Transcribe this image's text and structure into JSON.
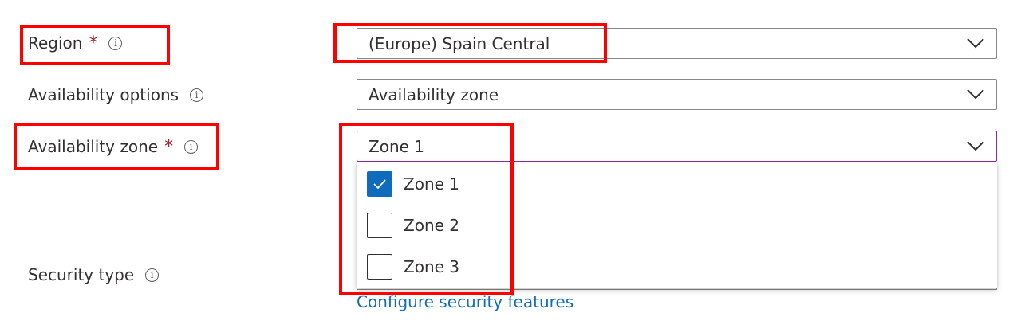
{
  "form": {
    "region": {
      "label": "Region",
      "required_mark": "*",
      "value": "(Europe) Spain Central"
    },
    "availability_options": {
      "label": "Availability options",
      "value": "Availability zone"
    },
    "availability_zone": {
      "label": "Availability zone",
      "required_mark": "*",
      "value": "Zone 1",
      "options": [
        {
          "label": "Zone 1",
          "checked": true
        },
        {
          "label": "Zone 2",
          "checked": false
        },
        {
          "label": "Zone 3",
          "checked": false
        }
      ]
    },
    "security_type": {
      "label": "Security type",
      "link": "Configure security features"
    }
  },
  "icons": {
    "info": "info-icon",
    "chevron": "chevron-down-icon",
    "check": "checkmark-icon"
  },
  "colors": {
    "required": "#a4262c",
    "link": "#0f6cbd",
    "checked": "#0f6cbd",
    "annotation": "#ff0000",
    "focus_border": "#8a2da5"
  }
}
